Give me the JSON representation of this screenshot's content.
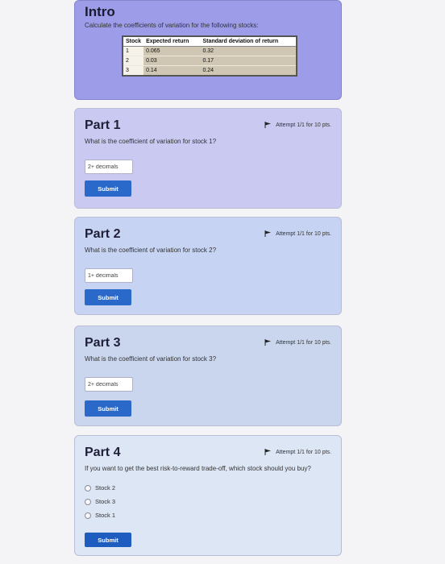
{
  "intro": {
    "title": "Intro",
    "prompt": "Calculate the coefficients of variation for the following stocks:",
    "table": {
      "headers": [
        "Stock",
        "Expected return",
        "Standard deviation of return"
      ],
      "rows": [
        [
          "1",
          "0.065",
          "0.32"
        ],
        [
          "2",
          "0.03",
          "0.17"
        ],
        [
          "3",
          "0.14",
          "0.24"
        ]
      ]
    }
  },
  "parts": [
    {
      "title": "Part 1",
      "attempt": "Attempt 1/1 for 10 pts.",
      "question": "What is the coefficient of variation for stock 1?",
      "placeholder": "2+ decimals",
      "submit": "Submit"
    },
    {
      "title": "Part 2",
      "attempt": "Attempt 1/1 for 10 pts.",
      "question": "What is the coefficient of variation for stock 2?",
      "placeholder": "1+ decimals",
      "submit": "Submit"
    },
    {
      "title": "Part 3",
      "attempt": "Attempt 1/1 for 10 pts.",
      "question": "What is the coefficient of variation for stock 3?",
      "placeholder": "2+ decimals",
      "submit": "Submit"
    },
    {
      "title": "Part 4",
      "attempt": "Attempt 1/1 for 10 pts.",
      "question": "If you want to get the best risk-to-reward trade-off, which stock should you buy?",
      "options": [
        "Stock 2",
        "Stock 3",
        "Stock 1"
      ],
      "submit": "Submit"
    }
  ],
  "icons": {
    "attempt": "flag-icon"
  },
  "colors": {
    "submit": "#2a68c9",
    "intro_bg": "#9c9ce8"
  }
}
